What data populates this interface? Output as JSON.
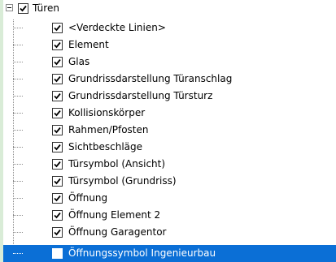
{
  "tree": {
    "parent": {
      "label": "Türen",
      "checked": true,
      "expanded": true
    },
    "children": [
      {
        "label": "<Verdeckte Linien>",
        "checked": true
      },
      {
        "label": "Element",
        "checked": true
      },
      {
        "label": "Glas",
        "checked": true
      },
      {
        "label": "Grundrissdarstellung Türanschlag",
        "checked": true
      },
      {
        "label": "Grundrissdarstellung Türsturz",
        "checked": true
      },
      {
        "label": "Kollisionskörper",
        "checked": true
      },
      {
        "label": "Rahmen/Pfosten",
        "checked": true
      },
      {
        "label": "Sichtbeschläge",
        "checked": true
      },
      {
        "label": "Türsymbol (Ansicht)",
        "checked": true
      },
      {
        "label": "Türsymbol (Grundriss)",
        "checked": true
      },
      {
        "label": "Öffnung",
        "checked": true
      },
      {
        "label": "Öffnung Element 2",
        "checked": true
      },
      {
        "label": "Öffnung Garagentor",
        "checked": true
      },
      {
        "label": "Öffnungssymbol Ingenieurbau",
        "checked": false,
        "selected": true
      }
    ]
  }
}
